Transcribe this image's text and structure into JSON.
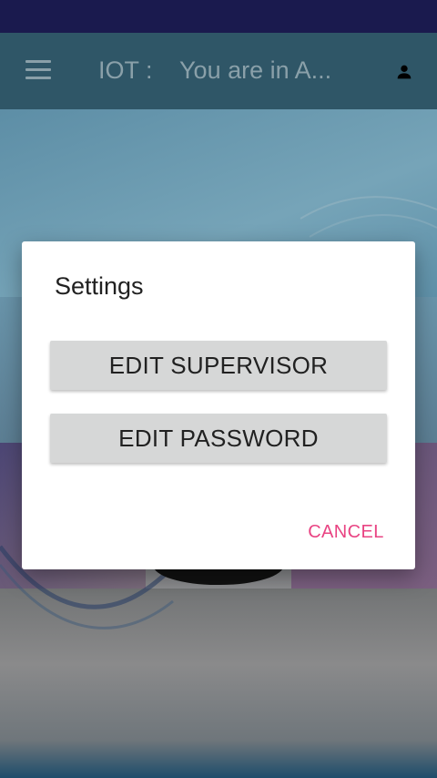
{
  "app_bar": {
    "title": "IOT :    You are in A...",
    "menu_icon": "hamburger-menu-icon",
    "account_icon": "person-icon"
  },
  "dialog": {
    "title": "Settings",
    "buttons": [
      {
        "label": "EDIT SUPERVISOR"
      },
      {
        "label": "EDIT PASSWORD"
      }
    ],
    "cancel_label": "CANCEL"
  },
  "colors": {
    "status_bar": "#1a1a4e",
    "accent": "#e94483",
    "button_bg": "#d6d7d7"
  }
}
